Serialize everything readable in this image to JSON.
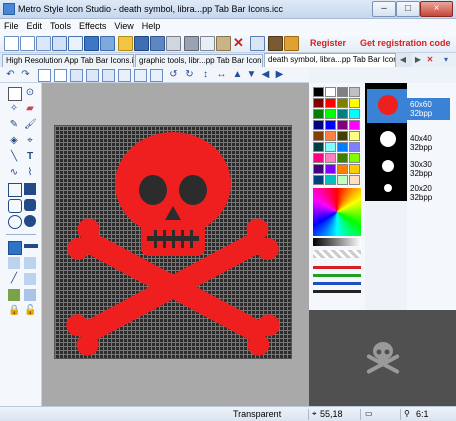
{
  "window": {
    "title": "Metro Style Icon Studio - death symbol, libra...pp Tab Bar Icons.icc",
    "buttons": {
      "minimize": "–",
      "maximize": "□",
      "close": "×"
    }
  },
  "menu": [
    "File",
    "Edit",
    "Tools",
    "Effects",
    "View",
    "Help"
  ],
  "toolbar": {
    "register_label": "Register",
    "get_code_label": "Get registration code"
  },
  "tabs": [
    {
      "label": "High Resolution App Tab Bar Icons.icc",
      "active": false
    },
    {
      "label": "graphic tools, libr...pp Tab Bar Icons.icc",
      "active": false
    },
    {
      "label": "death symbol, libra...pp Tab Bar Icons.icc",
      "active": true
    }
  ],
  "previews": [
    {
      "size": "60x60",
      "depth": "32bpp",
      "selected": true
    },
    {
      "size": "40x40",
      "depth": "32bpp",
      "selected": false
    },
    {
      "size": "30x30",
      "depth": "32bpp",
      "selected": false
    },
    {
      "size": "20x20",
      "depth": "32bpp",
      "selected": false
    }
  ],
  "palette": {
    "colors": [
      "#000000",
      "#ffffff",
      "#808080",
      "#c0c0c0",
      "#800000",
      "#ff0000",
      "#808000",
      "#ffff00",
      "#008000",
      "#00ff00",
      "#008080",
      "#00ffff",
      "#000080",
      "#0000ff",
      "#800080",
      "#ff00ff",
      "#804000",
      "#ff8040",
      "#404000",
      "#ffff80",
      "#004040",
      "#80ffff",
      "#0080ff",
      "#8080ff",
      "#ff0080",
      "#ff80c0",
      "#408000",
      "#80ff00",
      "#400080",
      "#8000ff",
      "#ff8000",
      "#ffcc00",
      "#004080",
      "#00c0c0",
      "#c0ffc0",
      "#ffe0c0"
    ],
    "current_color": "#ff2020"
  },
  "canvas": {
    "background": "#2c2c2c",
    "shape_color": "#ef1f1f"
  },
  "status": {
    "color_label": "Transparent",
    "coordinates": "55,18",
    "zoom": "6:1"
  }
}
